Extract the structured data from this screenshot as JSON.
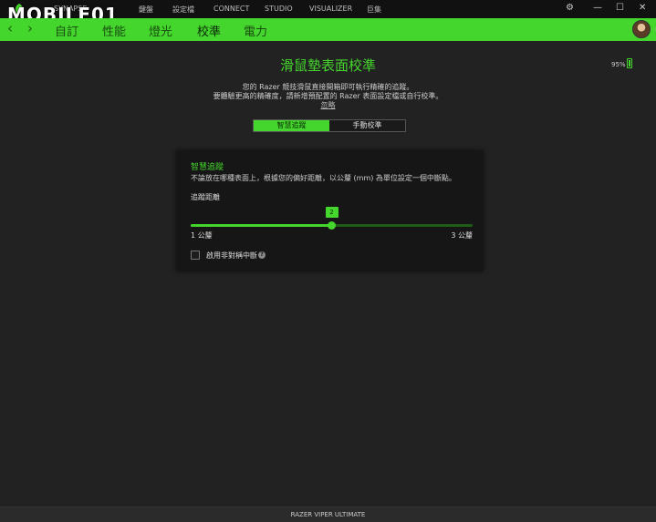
{
  "watermark": {
    "text": "MOBILE01"
  },
  "topnav": {
    "items": [
      {
        "label": "SYNAPSE"
      },
      {
        "label": "鍵盤"
      },
      {
        "label": "設定檔"
      },
      {
        "label": "CONNECT"
      },
      {
        "label": "STUDIO"
      },
      {
        "label": "VISUALIZER"
      },
      {
        "label": "巨集"
      }
    ]
  },
  "window_controls": {
    "settings": "⚙",
    "minimize": "—",
    "maximize": "☐",
    "close": "✕"
  },
  "greenbar": {
    "back_icon": "‹",
    "forward_icon": "›",
    "tabs": [
      {
        "label": "自訂"
      },
      {
        "label": "性能"
      },
      {
        "label": "燈光"
      },
      {
        "label": "校準"
      },
      {
        "label": "電力"
      }
    ],
    "active_tab": "校準"
  },
  "main": {
    "title": "滑鼠墊表面校準",
    "battery_text": "95%",
    "desc_line1": "您的 Razer 競技滑鼠直接開箱即可執行精確的追蹤。",
    "desc_line2": "要體驗更高的精確度，請新增預配置的 Razer 表面設定檔或自行校準。",
    "ignore_link": "忽略",
    "mode_smart": "智慧追蹤",
    "mode_manual": "手動校準",
    "active_mode": "smart"
  },
  "card": {
    "title": "智慧追蹤",
    "desc": "不論放在哪種表面上，根據您的偏好距離，以公釐 (mm) 為單位設定一個中斷點。",
    "slider_label": "追蹤距離",
    "slider_value": "2",
    "slider_min": 1,
    "slider_max": 3,
    "slider_current": 2,
    "slider_min_label": "1 公釐",
    "slider_max_label": "3 公釐",
    "checkbox_label": "啟用非對稱中斷",
    "checkbox_checked": false,
    "help_icon": "?"
  },
  "footer": {
    "device_name": "RAZER VIPER ULTIMATE"
  },
  "colors": {
    "accent": "#44d62c",
    "background": "#222222",
    "card": "#161616",
    "topbar": "#111111"
  }
}
